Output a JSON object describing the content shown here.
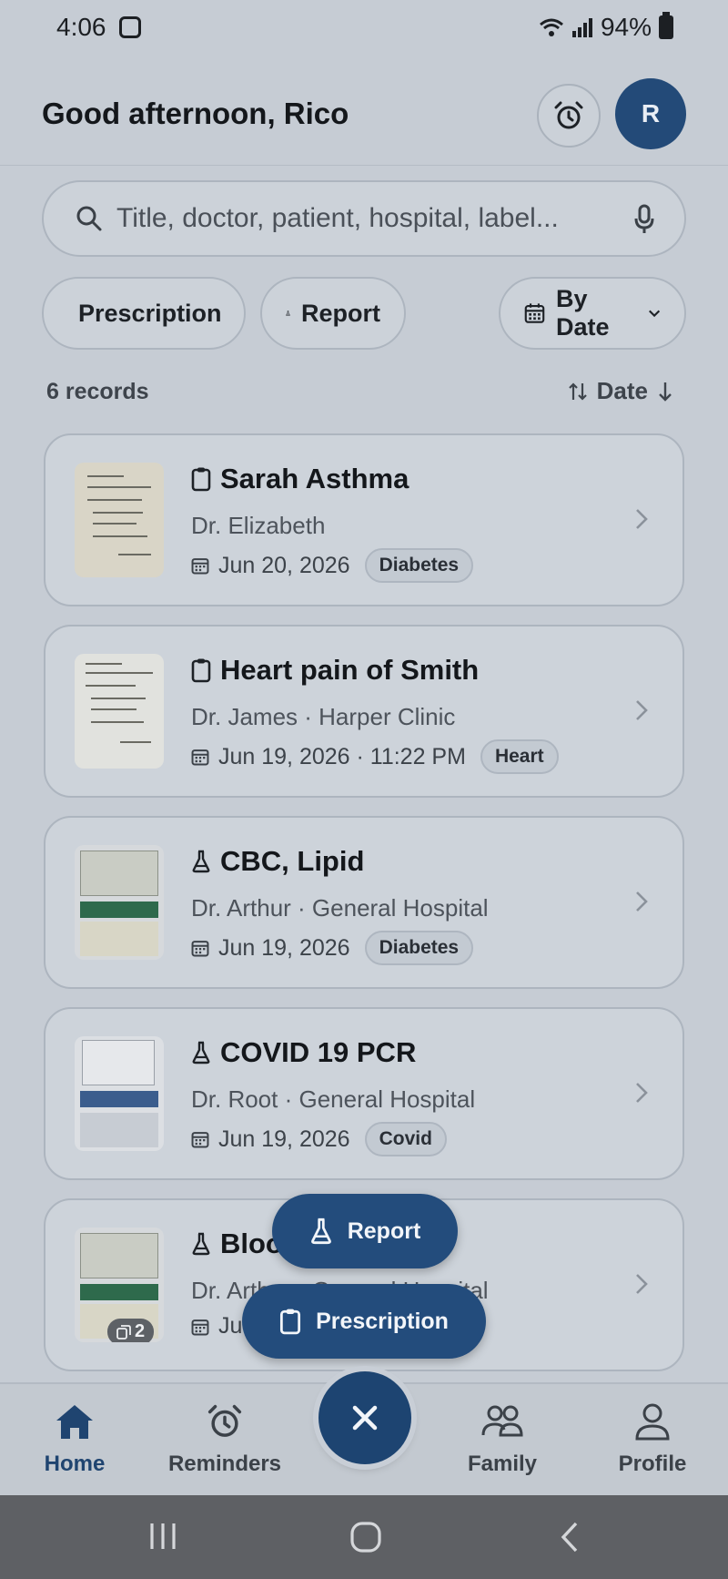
{
  "status_bar": {
    "time": "4:06",
    "battery": "94%"
  },
  "header": {
    "greeting": "Good afternoon, Rico",
    "avatar_initial": "R"
  },
  "search": {
    "placeholder": "Title, doctor, patient, hospital, label..."
  },
  "filters": {
    "prescription_label": "Prescription",
    "report_label": "Report",
    "date_label": "By Date"
  },
  "records": {
    "count_label": "6 records",
    "sort_label": "Date",
    "items": [
      {
        "type": "prescription",
        "title": "Sarah Asthma",
        "subtitle": "Dr. Elizabeth",
        "date": "Jun 20, 2026",
        "tag": "Diabetes"
      },
      {
        "type": "prescription",
        "title": "Heart pain of Smith",
        "subtitle": "Dr. James  ·  Harper Clinic",
        "date": "Jun 19, 2026 · 11:22 PM",
        "tag": "Heart"
      },
      {
        "type": "report",
        "title": "CBC, Lipid",
        "subtitle": "Dr. Arthur  ·  General Hospital",
        "date": "Jun 19, 2026",
        "tag": "Diabetes"
      },
      {
        "type": "report",
        "title": "COVID 19 PCR",
        "subtitle": "Dr. Root  ·  General Hospital",
        "date": "Jun 19, 2026",
        "tag": "Covid"
      },
      {
        "type": "report",
        "title": "Bloo",
        "subtitle": "Dr. Arthur  ·  General Hospital",
        "date": "Ju",
        "pages": "2"
      }
    ]
  },
  "fab_menu": {
    "report_label": "Report",
    "prescription_label": "Prescription"
  },
  "bottom_nav": {
    "home": "Home",
    "reminders": "Reminders",
    "family": "Family",
    "profile": "Profile"
  },
  "colors": {
    "accent": "#234c7c",
    "background": "#c6ccd4"
  }
}
